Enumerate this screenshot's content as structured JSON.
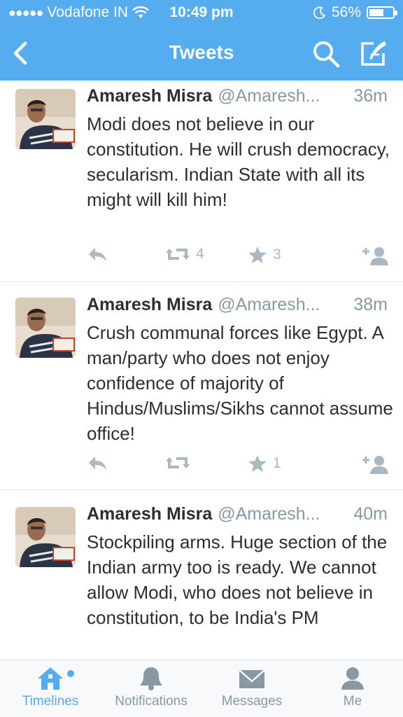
{
  "status_bar": {
    "carrier": "Vodafone IN",
    "time": "10:49 pm",
    "battery": "56%",
    "battery_level": 0.56
  },
  "nav": {
    "title": "Tweets"
  },
  "tweets": [
    {
      "name": "Amaresh Misra",
      "handle": "@Amaresh...",
      "time": "36m",
      "text": "Modi does not believe in our constitution. He will crush democracy, secularism. Indian State with all its might will kill him!",
      "retweets": "4",
      "favorites": "3"
    },
    {
      "name": "Amaresh Misra",
      "handle": "@Amaresh...",
      "time": "38m",
      "text": "Crush communal forces like Egypt. A man/party who does not enjoy confidence of majority of Hindus/Muslims/Sikhs cannot assume office!",
      "retweets": "",
      "favorites": "1"
    },
    {
      "name": "Amaresh Misra",
      "handle": "@Amaresh...",
      "time": "40m",
      "text": "Stockpiling arms. Huge section of the Indian army too is ready. We cannot allow Modi, who does not believe in constitution, to be India's PM"
    }
  ],
  "tabs": [
    {
      "label": "Timelines",
      "icon": "home-icon",
      "active": true
    },
    {
      "label": "Notifications",
      "icon": "bell-icon"
    },
    {
      "label": "Messages",
      "icon": "envelope-icon"
    },
    {
      "label": "Me",
      "icon": "person-icon"
    }
  ],
  "colors": {
    "brand": "#55acee",
    "text": "#292f33",
    "muted": "#8899a6",
    "icon": "#aab8c2"
  }
}
